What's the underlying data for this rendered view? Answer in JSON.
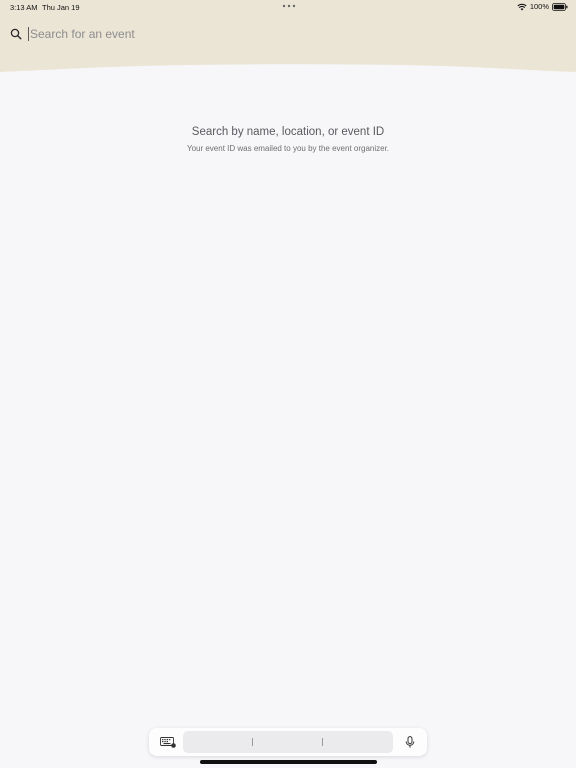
{
  "status_bar": {
    "time": "3:13 AM",
    "date": "Thu Jan 19",
    "battery": "100%"
  },
  "search": {
    "placeholder": "Search for an event",
    "value": ""
  },
  "empty_state": {
    "title": "Search by name, location, or event ID",
    "subtitle": "Your event ID was emailed to you by the event organizer."
  },
  "colors": {
    "header_bg": "#ebe5d6",
    "page_bg": "#f7f7f9"
  },
  "icons": {
    "search": "search-icon",
    "keyboard": "keyboard-icon",
    "mic": "microphone-icon",
    "wifi": "wifi-icon",
    "battery": "battery-icon"
  }
}
